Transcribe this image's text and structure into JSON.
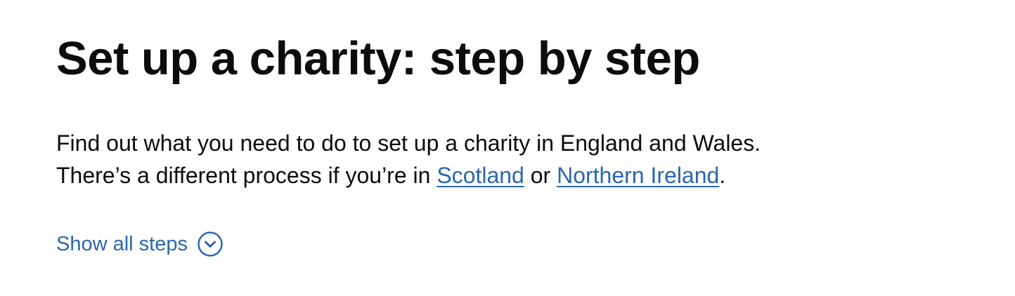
{
  "header": {
    "title": "Set up a charity: step by step"
  },
  "intro": {
    "line1": "Find out what you need to do to set up a charity in England and Wales.",
    "line2_prefix": "There’s a different process if you’re in ",
    "link_scotland": "Scotland",
    "line2_middle": " or ",
    "link_northern_ireland": "Northern Ireland",
    "line2_suffix": "."
  },
  "controls": {
    "show_all_label": "Show all steps",
    "show_all_icon": "chevron-down-circle-icon"
  },
  "colors": {
    "text": "#0b0c0c",
    "link": "#2b66b0",
    "background": "#ffffff"
  }
}
